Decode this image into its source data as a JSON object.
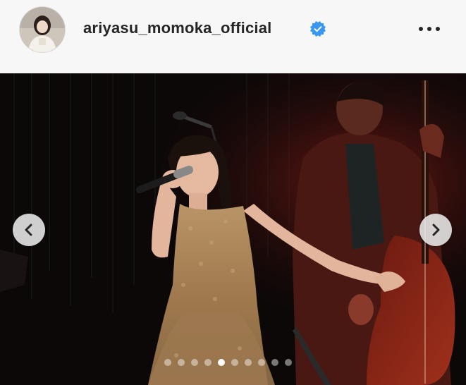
{
  "post": {
    "username": "ariyasu_momoka_official",
    "verified": true,
    "verified_color": "#3897f0"
  },
  "carousel": {
    "slide_count": 10,
    "active_index": 4,
    "prev_icon": "chevron-left-icon",
    "next_icon": "chevron-right-icon"
  },
  "header": {
    "more_icon": "more-horizontal-icon"
  }
}
